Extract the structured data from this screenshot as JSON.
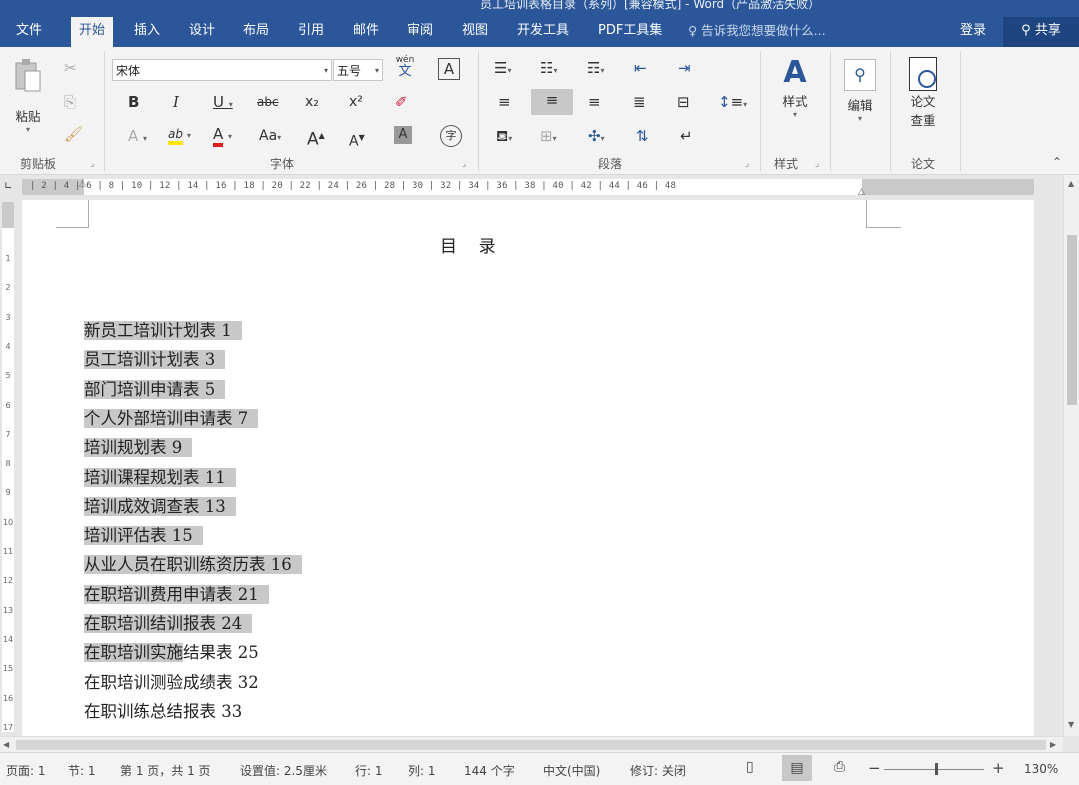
{
  "window": {
    "title": "员工培训表格目录（系列）[兼容模式] - Word（产品激活失败）"
  },
  "tabs": [
    "文件",
    "开始",
    "插入",
    "设计",
    "布局",
    "引用",
    "邮件",
    "审阅",
    "视图",
    "开发工具",
    "PDF工具集"
  ],
  "active_tab": "开始",
  "tell_me": "告诉我您想要做什么...",
  "login": "登录",
  "share": "共享",
  "ribbon": {
    "clipboard": {
      "paste": "粘贴",
      "label": "剪贴板"
    },
    "font": {
      "name": "宋体",
      "size": "五号",
      "label": "字体",
      "bold": "B",
      "italic": "I",
      "underline": "U",
      "strike": "abc",
      "subscript": "x₂",
      "superscript": "x²",
      "phonetic_top": "wén",
      "phonetic_bottom": "文",
      "border_char": "A",
      "case": "Aa",
      "grow": "A",
      "shrink": "A",
      "shading": "A",
      "enclose": "字",
      "highlight": "ab",
      "color": "A",
      "effects": "A"
    },
    "paragraph": {
      "label": "段落"
    },
    "styles": {
      "button": "样式",
      "label": "样式"
    },
    "editing": {
      "button": "编辑"
    },
    "paper": {
      "button_line1": "论文",
      "button_line2": "查重",
      "label": "论文"
    }
  },
  "document": {
    "title": "目    录",
    "toc": [
      {
        "text": "新员工培训计划表 1",
        "highlight": "新员工培训计划表 1",
        "rest": ""
      },
      {
        "text": "员工培训计划表 3",
        "highlight": "员工培训计划表 3",
        "rest": ""
      },
      {
        "text": "部门培训申请表 5",
        "highlight": "部门培训申请表 5",
        "rest": ""
      },
      {
        "text": "个人外部培训申请表 7",
        "highlight": "个人外部培训申请表 7",
        "rest": ""
      },
      {
        "text": "培训规划表 9",
        "highlight": "培训规划表 9",
        "rest": ""
      },
      {
        "text": "培训课程规划表 11",
        "highlight": "培训课程规划表 11",
        "rest": ""
      },
      {
        "text": "培训成效调查表 13",
        "highlight": "培训成效调查表 13",
        "rest": ""
      },
      {
        "text": "培训评估表 15",
        "highlight": "培训评估表 15",
        "rest": ""
      },
      {
        "text": "从业人员在职训练资历表 16",
        "highlight": "从业人员在职训练资历表 16",
        "rest": ""
      },
      {
        "text": "在职培训费用申请表 21",
        "highlight": "在职培训费用申请表 21",
        "rest": ""
      },
      {
        "text": "在职培训结训报表 24",
        "highlight": "在职培训结训报表 24",
        "rest": ""
      },
      {
        "text": "在职培训实施结果表 25",
        "highlight": "在职培训实施",
        "rest": "结果表 25"
      },
      {
        "text": "在职培训测验成绩表 32",
        "highlight": "",
        "rest": "在职培训测验成绩表 32"
      },
      {
        "text": "在职训练总结报表 33",
        "highlight": "",
        "rest": "在职训练总结报表 33"
      }
    ]
  },
  "ruler": {
    "left_num": "2",
    "numbers": "| 2 |  4  | 6 |  8 | 10 | 12 | 14 | 16 | 18 | 20 | 22 | 24 | 26 | 28 | 30 | 32 | 34 | 36 | 38 | 40 | 42 | 44 | 46 | 48",
    "vertical": [
      "1",
      "2",
      "3",
      "4",
      "5",
      "6",
      "7",
      "8",
      "9",
      "10",
      "11",
      "12",
      "13",
      "14",
      "15",
      "16",
      "17"
    ]
  },
  "status": {
    "page": "页面: 1",
    "section": "节: 1",
    "page_of": "第 1 页，共 1 页",
    "position": "设置值: 2.5厘米",
    "line": "行: 1",
    "column": "列: 1",
    "words": "144 个字",
    "language": "中文(中国)",
    "track": "修订: 关闭",
    "zoom": "130%"
  },
  "colors": {
    "brand": "#2b579a",
    "highlight": "#c8c8c8",
    "underline_red": "#e11c1c",
    "highlight_yellow": "#ffe600"
  }
}
